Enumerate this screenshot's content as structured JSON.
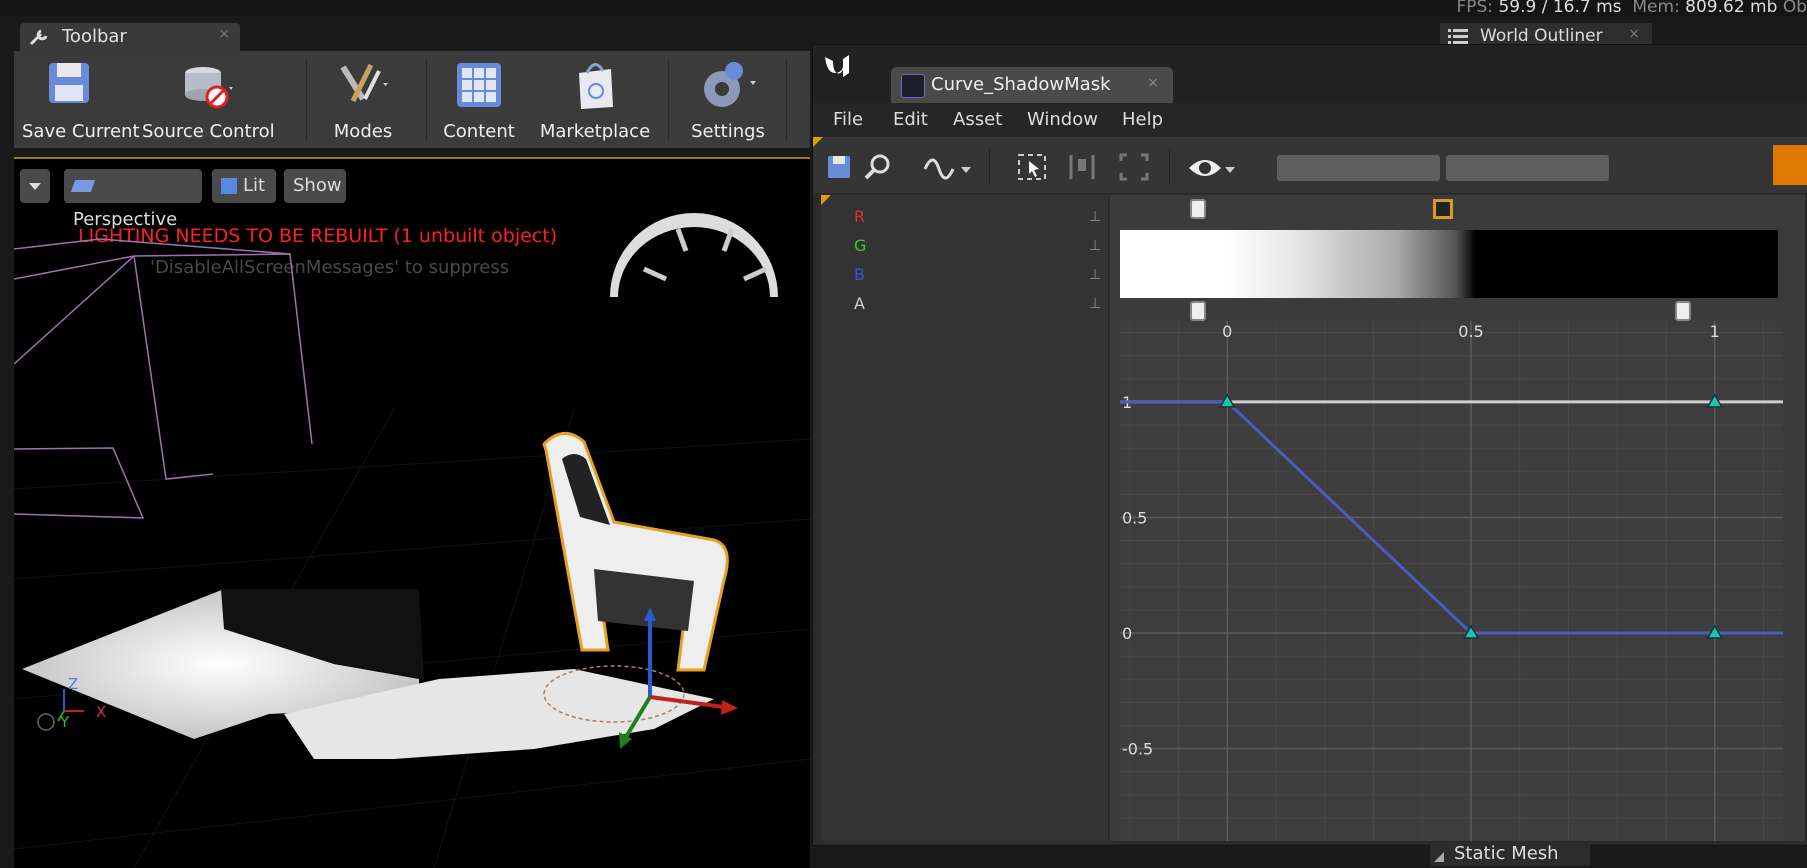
{
  "stats": {
    "fps_label": "FPS:",
    "fps": "59.9",
    "ms": "/ 16.7 ms",
    "mem_label": "Mem:",
    "mem": "809.62 mb",
    "ob": "Ob"
  },
  "toolbar": {
    "tab_title": "Toolbar",
    "close": "×",
    "buttons": {
      "save": "Save Current",
      "source": "Source Control",
      "modes": "Modes",
      "content": "Content",
      "marketplace": "Marketplace",
      "settings": "Settings"
    }
  },
  "viewport": {
    "perspective": "Perspective",
    "lit": "Lit",
    "show": "Show",
    "warning": "LIGHTING NEEDS TO BE REBUILT (1 unbuilt object)",
    "suppress": "'DisableAllScreenMessages' to suppress",
    "axis": {
      "z": "Z",
      "y": "Y",
      "x": "X"
    }
  },
  "outliner": {
    "title": "World Outliner",
    "close": "×"
  },
  "static_mesh": {
    "title": "Static Mesh"
  },
  "editor": {
    "tab_title": "Curve_ShadowMask",
    "close": "×",
    "menu": {
      "file": "File",
      "edit": "Edit",
      "asset": "Asset",
      "window": "Window",
      "help": "Help"
    },
    "channels": [
      {
        "label": "R",
        "color": "#e03030"
      },
      {
        "label": "G",
        "color": "#30d030"
      },
      {
        "label": "B",
        "color": "#4050e0"
      },
      {
        "label": "A",
        "color": "#d0d0d0"
      }
    ],
    "x_ticks": [
      "0",
      "0.5",
      "1"
    ],
    "y_ticks": [
      "1",
      "0.5",
      "0",
      "-0.5"
    ]
  },
  "chart_data": {
    "type": "line",
    "x": [
      0,
      0.5,
      1
    ],
    "series": [
      {
        "name": "B",
        "values": [
          1,
          0,
          0
        ],
        "color": "#4a5cc0"
      },
      {
        "name": "A",
        "values": [
          1,
          1,
          1
        ],
        "color": "#cfcfcf"
      }
    ],
    "xlim": [
      -0.22,
      1.14
    ],
    "ylim": [
      -0.9,
      1.35
    ]
  }
}
